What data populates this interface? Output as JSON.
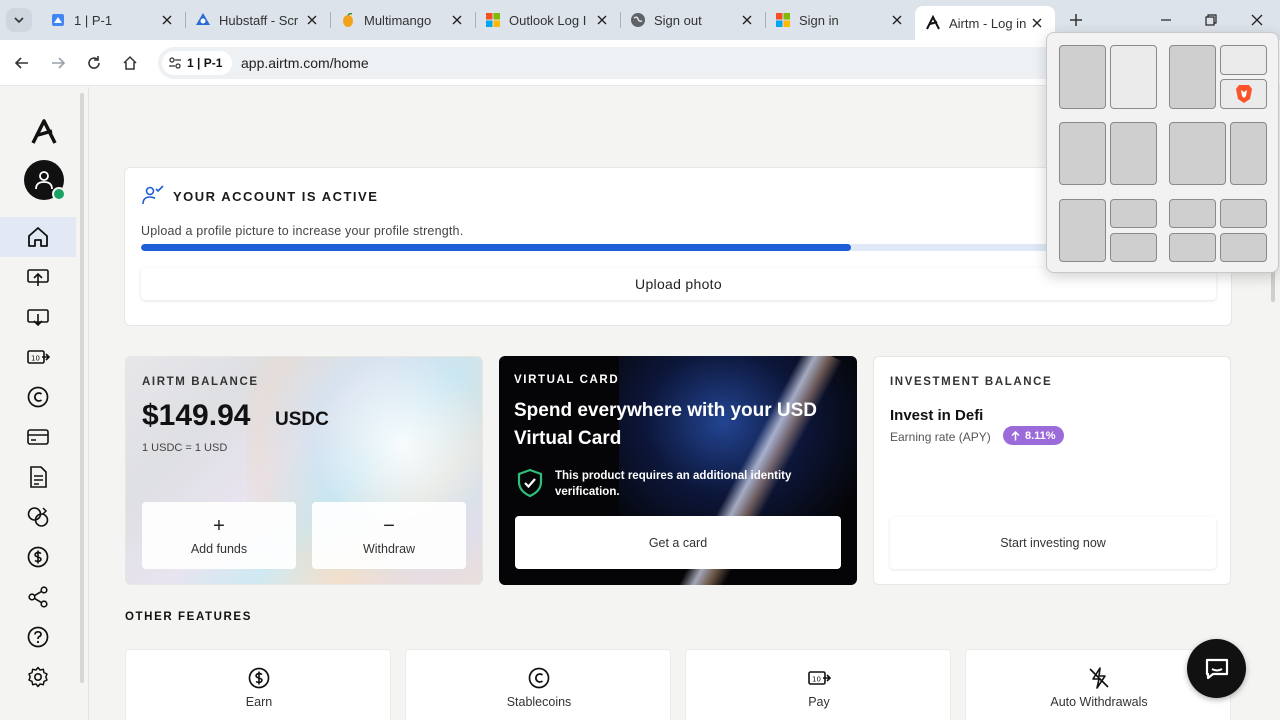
{
  "browser": {
    "tabs": [
      {
        "title": "1 | P-1",
        "icon": "google-maps-icon"
      },
      {
        "title": "Hubstaff - Scr",
        "icon": "hubstaff-icon"
      },
      {
        "title": "Multimango",
        "icon": "multimango-icon"
      },
      {
        "title": "Outlook Log I",
        "icon": "microsoft-icon"
      },
      {
        "title": "Sign out",
        "icon": "globe-icon"
      },
      {
        "title": "Sign in",
        "icon": "microsoft-icon"
      },
      {
        "title": "Airtm - Log in",
        "icon": "airtm-icon",
        "active": true
      }
    ],
    "site_chip": "1 | P-1",
    "url": "app.airtm.com/home"
  },
  "account": {
    "title": "YOUR ACCOUNT IS ACTIVE",
    "description": "Upload a profile picture to increase your profile strength.",
    "progress": 0.66,
    "upload_label": "Upload photo"
  },
  "balance": {
    "label": "AIRTM BALANCE",
    "amount": "$149.94",
    "unit": "USDC",
    "rate": "1 USDC = 1 USD",
    "add_funds": "Add funds",
    "withdraw": "Withdraw"
  },
  "virtual_card": {
    "label": "VIRTUAL CARD",
    "title": "Spend everywhere with your USD Virtual Card",
    "notice": "This product requires an additional identity verification.",
    "button": "Get a card"
  },
  "investment": {
    "label": "INVESTMENT BALANCE",
    "heading": "Invest in Defi",
    "rate_label": "Earning rate (APY)",
    "apy": "8.11%",
    "button": "Start investing now"
  },
  "other_features": {
    "title": "OTHER FEATURES",
    "items": [
      {
        "label": "Earn",
        "icon": "dollar-circle-icon"
      },
      {
        "label": "Stablecoins",
        "icon": "stablecoin-icon"
      },
      {
        "label": "Pay",
        "icon": "pay-icon"
      },
      {
        "label": "Auto Withdrawals",
        "icon": "auto-withdrawal-icon"
      }
    ]
  },
  "colors": {
    "progress": "#1e5fd8",
    "apy_pill": "#9b6cd9",
    "verified_badge": "#1aa266"
  }
}
